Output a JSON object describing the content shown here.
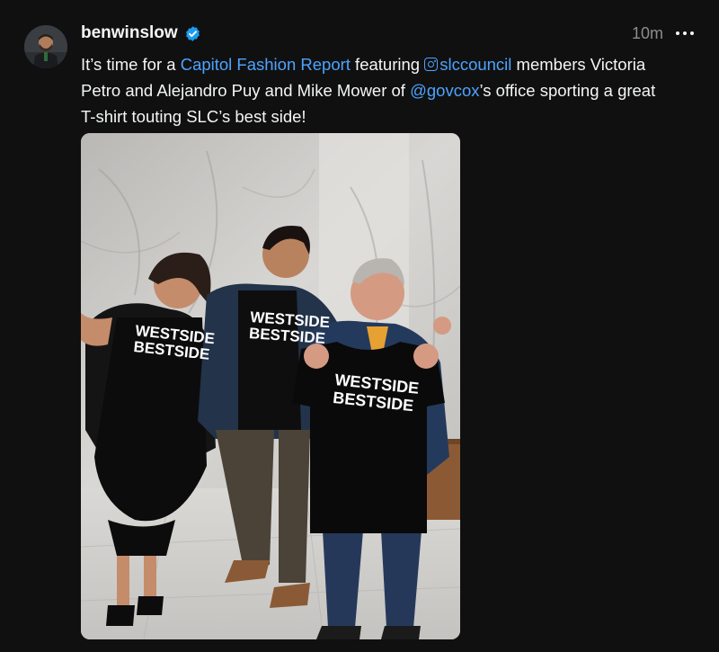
{
  "post": {
    "username": "benwinslow",
    "verified": true,
    "timestamp": "10m",
    "more_icon": "ellipsis-icon",
    "caption": {
      "t1": "It’s time for a ",
      "link1": "Capitol Fashion Report",
      "t2": " featuring ",
      "mention1": "slccouncil",
      "mention1_icon": "instagram-icon",
      "t3": " members Victoria Petro and Alejandro Puy and Mike Mower of ",
      "mention2": "@govcox",
      "t4": "’s office sporting a great T-shirt touting SLC’s best side!"
    },
    "photo": {
      "shirt_line1": "WESTSIDE",
      "shirt_line2": "BESTSIDE"
    }
  },
  "colors": {
    "background": "#101010",
    "text": "#f3f5f7",
    "secondary_text": "#8c8c8c",
    "link": "#4da3ff",
    "verified_badge": "#1d9bf0"
  }
}
